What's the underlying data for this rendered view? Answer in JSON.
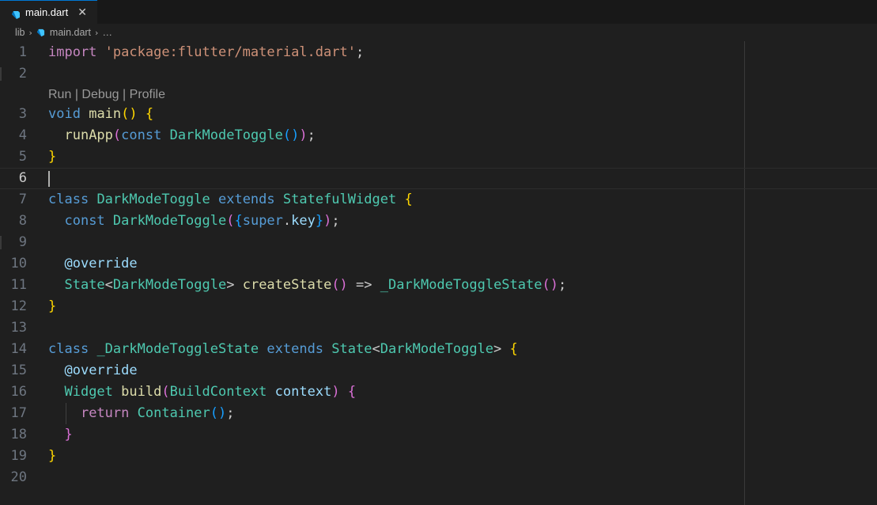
{
  "tab": {
    "label": "main.dart",
    "close": "✕",
    "icon": "dart-icon"
  },
  "breadcrumb": {
    "folder": "lib",
    "file": "main.dart",
    "ellipsis": "…"
  },
  "codelens": {
    "run": "Run",
    "debug": "Debug",
    "profile": "Profile",
    "separator": "|"
  },
  "lines": {
    "n1": "1",
    "n2": "2",
    "n3": "3",
    "n4": "4",
    "n5": "5",
    "n6": "6",
    "n7": "7",
    "n8": "8",
    "n9": "9",
    "n10": "10",
    "n11": "11",
    "n12": "12",
    "n13": "13",
    "n14": "14",
    "n15": "15",
    "n16": "16",
    "n17": "17",
    "n18": "18",
    "n19": "19",
    "n20": "20"
  },
  "code": {
    "import_kw": "import",
    "import_str": "'package:flutter/material.dart'",
    "semi": ";",
    "void_kw": "void",
    "main_fn": "main",
    "runApp": "runApp",
    "const_kw": "const",
    "DarkModeToggle": "DarkModeToggle",
    "class_kw": "class",
    "extends_kw": "extends",
    "StatefulWidget": "StatefulWidget",
    "super_kw": "super",
    "key": "key",
    "override": "@override",
    "State": "State",
    "createState": "createState",
    "arrow": "=>",
    "DarkModeToggleState": "_DarkModeToggleState",
    "Widget": "Widget",
    "build": "build",
    "BuildContext": "BuildContext",
    "context": "context",
    "return_kw": "return",
    "Container": "Container"
  },
  "colors": {
    "background": "#1f1f1f",
    "keyword": "#569cd6",
    "control": "#c586c0",
    "string": "#ce9178",
    "type": "#4ec9b0",
    "function": "#dcdcaa",
    "variable": "#9cdcfe",
    "bracket1": "#ffd700",
    "bracket2": "#da70d6",
    "bracket3": "#179fff"
  }
}
